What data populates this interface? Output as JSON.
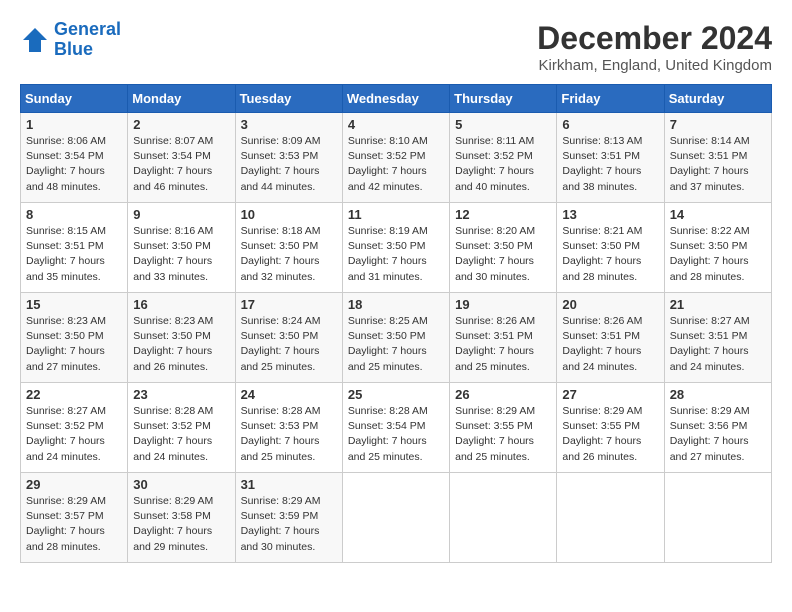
{
  "logo": {
    "line1": "General",
    "line2": "Blue"
  },
  "title": "December 2024",
  "location": "Kirkham, England, United Kingdom",
  "days_header": [
    "Sunday",
    "Monday",
    "Tuesday",
    "Wednesday",
    "Thursday",
    "Friday",
    "Saturday"
  ],
  "weeks": [
    [
      {
        "day": "1",
        "info": "Sunrise: 8:06 AM\nSunset: 3:54 PM\nDaylight: 7 hours\nand 48 minutes."
      },
      {
        "day": "2",
        "info": "Sunrise: 8:07 AM\nSunset: 3:54 PM\nDaylight: 7 hours\nand 46 minutes."
      },
      {
        "day": "3",
        "info": "Sunrise: 8:09 AM\nSunset: 3:53 PM\nDaylight: 7 hours\nand 44 minutes."
      },
      {
        "day": "4",
        "info": "Sunrise: 8:10 AM\nSunset: 3:52 PM\nDaylight: 7 hours\nand 42 minutes."
      },
      {
        "day": "5",
        "info": "Sunrise: 8:11 AM\nSunset: 3:52 PM\nDaylight: 7 hours\nand 40 minutes."
      },
      {
        "day": "6",
        "info": "Sunrise: 8:13 AM\nSunset: 3:51 PM\nDaylight: 7 hours\nand 38 minutes."
      },
      {
        "day": "7",
        "info": "Sunrise: 8:14 AM\nSunset: 3:51 PM\nDaylight: 7 hours\nand 37 minutes."
      }
    ],
    [
      {
        "day": "8",
        "info": "Sunrise: 8:15 AM\nSunset: 3:51 PM\nDaylight: 7 hours\nand 35 minutes."
      },
      {
        "day": "9",
        "info": "Sunrise: 8:16 AM\nSunset: 3:50 PM\nDaylight: 7 hours\nand 33 minutes."
      },
      {
        "day": "10",
        "info": "Sunrise: 8:18 AM\nSunset: 3:50 PM\nDaylight: 7 hours\nand 32 minutes."
      },
      {
        "day": "11",
        "info": "Sunrise: 8:19 AM\nSunset: 3:50 PM\nDaylight: 7 hours\nand 31 minutes."
      },
      {
        "day": "12",
        "info": "Sunrise: 8:20 AM\nSunset: 3:50 PM\nDaylight: 7 hours\nand 30 minutes."
      },
      {
        "day": "13",
        "info": "Sunrise: 8:21 AM\nSunset: 3:50 PM\nDaylight: 7 hours\nand 28 minutes."
      },
      {
        "day": "14",
        "info": "Sunrise: 8:22 AM\nSunset: 3:50 PM\nDaylight: 7 hours\nand 28 minutes."
      }
    ],
    [
      {
        "day": "15",
        "info": "Sunrise: 8:23 AM\nSunset: 3:50 PM\nDaylight: 7 hours\nand 27 minutes."
      },
      {
        "day": "16",
        "info": "Sunrise: 8:23 AM\nSunset: 3:50 PM\nDaylight: 7 hours\nand 26 minutes."
      },
      {
        "day": "17",
        "info": "Sunrise: 8:24 AM\nSunset: 3:50 PM\nDaylight: 7 hours\nand 25 minutes."
      },
      {
        "day": "18",
        "info": "Sunrise: 8:25 AM\nSunset: 3:50 PM\nDaylight: 7 hours\nand 25 minutes."
      },
      {
        "day": "19",
        "info": "Sunrise: 8:26 AM\nSunset: 3:51 PM\nDaylight: 7 hours\nand 25 minutes."
      },
      {
        "day": "20",
        "info": "Sunrise: 8:26 AM\nSunset: 3:51 PM\nDaylight: 7 hours\nand 24 minutes."
      },
      {
        "day": "21",
        "info": "Sunrise: 8:27 AM\nSunset: 3:51 PM\nDaylight: 7 hours\nand 24 minutes."
      }
    ],
    [
      {
        "day": "22",
        "info": "Sunrise: 8:27 AM\nSunset: 3:52 PM\nDaylight: 7 hours\nand 24 minutes."
      },
      {
        "day": "23",
        "info": "Sunrise: 8:28 AM\nSunset: 3:52 PM\nDaylight: 7 hours\nand 24 minutes."
      },
      {
        "day": "24",
        "info": "Sunrise: 8:28 AM\nSunset: 3:53 PM\nDaylight: 7 hours\nand 25 minutes."
      },
      {
        "day": "25",
        "info": "Sunrise: 8:28 AM\nSunset: 3:54 PM\nDaylight: 7 hours\nand 25 minutes."
      },
      {
        "day": "26",
        "info": "Sunrise: 8:29 AM\nSunset: 3:55 PM\nDaylight: 7 hours\nand 25 minutes."
      },
      {
        "day": "27",
        "info": "Sunrise: 8:29 AM\nSunset: 3:55 PM\nDaylight: 7 hours\nand 26 minutes."
      },
      {
        "day": "28",
        "info": "Sunrise: 8:29 AM\nSunset: 3:56 PM\nDaylight: 7 hours\nand 27 minutes."
      }
    ],
    [
      {
        "day": "29",
        "info": "Sunrise: 8:29 AM\nSunset: 3:57 PM\nDaylight: 7 hours\nand 28 minutes."
      },
      {
        "day": "30",
        "info": "Sunrise: 8:29 AM\nSunset: 3:58 PM\nDaylight: 7 hours\nand 29 minutes."
      },
      {
        "day": "31",
        "info": "Sunrise: 8:29 AM\nSunset: 3:59 PM\nDaylight: 7 hours\nand 30 minutes."
      },
      {
        "day": "",
        "info": ""
      },
      {
        "day": "",
        "info": ""
      },
      {
        "day": "",
        "info": ""
      },
      {
        "day": "",
        "info": ""
      }
    ]
  ]
}
